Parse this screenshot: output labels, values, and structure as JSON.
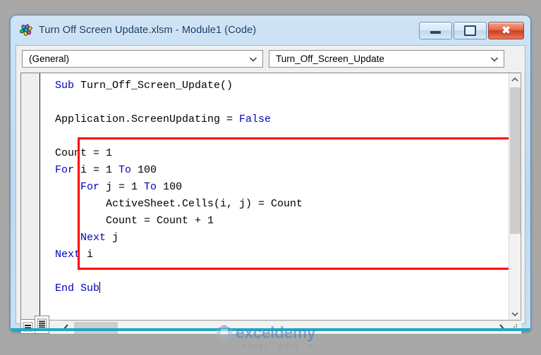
{
  "window": {
    "title": "Turn Off Screen Update.xlsm - Module1 (Code)",
    "icon": "vba-module-icon",
    "minimize_label": "Minimize",
    "maximize_label": "Maximize",
    "close_label": "Close"
  },
  "toolbar": {
    "object_combo": {
      "value": "(General)",
      "chevron": "chevron-down-icon"
    },
    "procedure_combo": {
      "value": "Turn_Off_Screen_Update",
      "chevron": "chevron-down-icon"
    }
  },
  "code": {
    "lines": [
      "Sub Turn_Off_Screen_Update()",
      "",
      "Application.ScreenUpdating = False",
      "",
      "Count = 1",
      "For i = 1 To 100",
      "    For j = 1 To 100",
      "        ActiveSheet.Cells(i, j) = Count",
      "        Count = Count + 1",
      "    Next j",
      "Next i",
      "",
      "End Sub"
    ],
    "keywords": [
      "Sub",
      "End",
      "For",
      "To",
      "Next",
      "False"
    ],
    "keyword_color": "#0000C0",
    "text_color": "#000000",
    "caret_after": "End Sub"
  },
  "annotation": {
    "red_box_color": "#FF0000",
    "covers_lines": "Count = 1 through Next i"
  },
  "scroll": {
    "vertical_up": "scroll-up-arrow",
    "vertical_down": "scroll-down-arrow",
    "horizontal_left": "scroll-left-arrow",
    "horizontal_right": "scroll-right-arrow"
  },
  "view_buttons": {
    "procedure_view": "Procedure View",
    "full_module_view": "Full Module View"
  },
  "watermark": {
    "name": "exceldemy",
    "tagline": "EXCEL · DATA · BI"
  }
}
